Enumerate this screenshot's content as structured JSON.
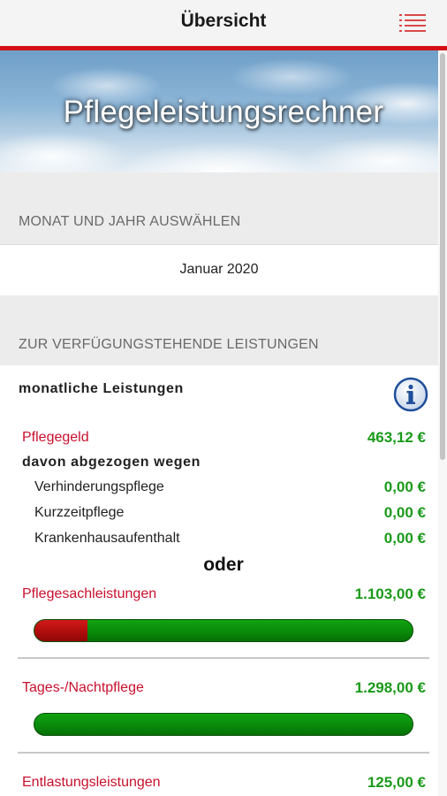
{
  "header": {
    "title": "Übersicht",
    "menu_icon": "list-menu-icon"
  },
  "hero": {
    "title": "Pflegeleistungsrechner"
  },
  "month_section": {
    "heading": "MONAT UND JAHR AUSWÄHLEN",
    "selected": "Januar 2020"
  },
  "benefits_section": {
    "heading": "ZUR VERFÜGUNGSTEHENDE LEISTUNGEN",
    "monthly_title": "monatliche Leistungen",
    "info_icon": "info-icon",
    "pflegegeld": {
      "label": "Pflegegeld",
      "value": "463,12 €"
    },
    "deducted_title": "davon abgezogen wegen",
    "deductions": [
      {
        "label": "Verhinderungspflege",
        "value": "0,00 €"
      },
      {
        "label": "Kurzzeitpflege",
        "value": "0,00 €"
      },
      {
        "label": "Krankenhausaufenthalt",
        "value": "0,00 €"
      }
    ],
    "or_label": "oder",
    "sachleistungen": {
      "label": "Pflegesachleistungen",
      "value": "1.103,00 €",
      "used_fraction": 0.14
    },
    "tagespflege": {
      "label": "Tages-/Nachtpflege",
      "value": "1.298,00 €",
      "used_fraction": 0.0
    },
    "entlastung": {
      "label": "Entlastungsleistungen",
      "value": "125,00 €"
    }
  },
  "colors": {
    "accent": "#d40f14",
    "label_red": "#c8102e",
    "value_green": "#1a9a1a",
    "bar_green": "#0a8a0a",
    "bar_red": "#b00d0d"
  }
}
